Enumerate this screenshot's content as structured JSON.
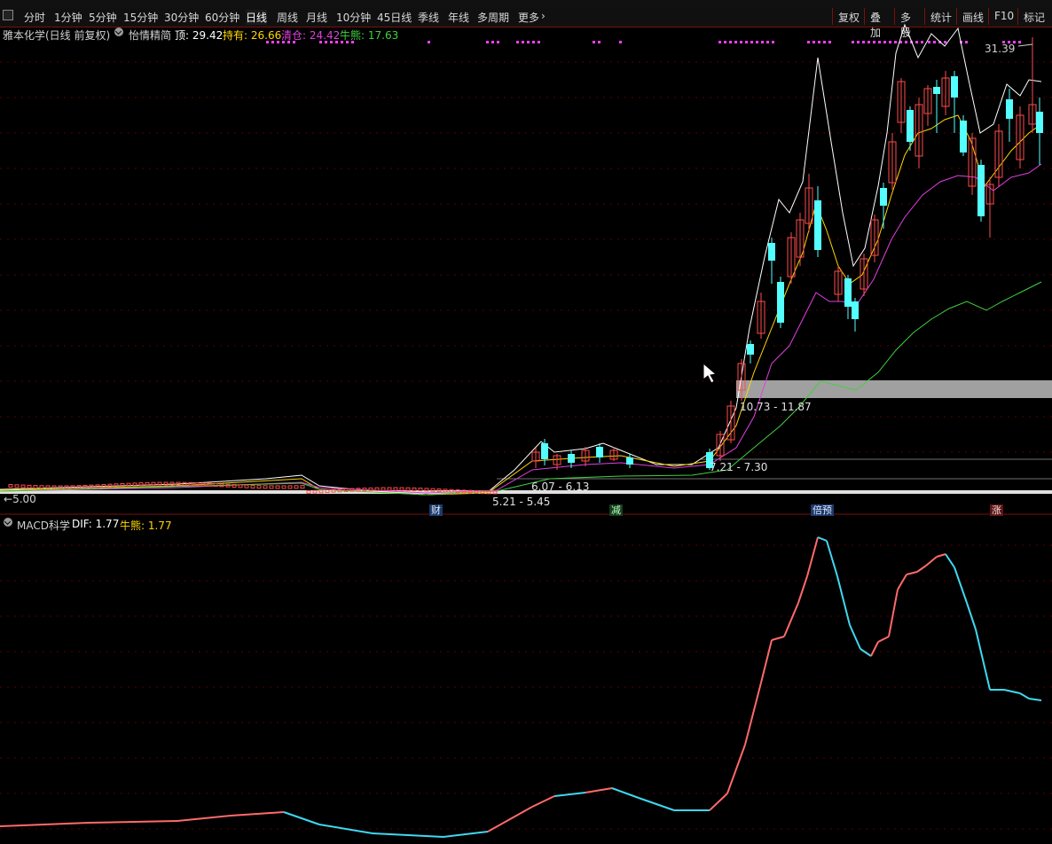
{
  "toolbar": {
    "periods": [
      "分时",
      "1分钟",
      "5分钟",
      "15分钟",
      "30分钟",
      "60分钟",
      "日线",
      "周线",
      "月线",
      "10分钟",
      "45日线",
      "季线",
      "年线",
      "多周期",
      "更多"
    ],
    "active_period": "日线",
    "right_buttons": [
      "复权",
      "叠加",
      "多股",
      "统计",
      "画线",
      "F10",
      "标记"
    ]
  },
  "main_info": {
    "title": "雅本化学(日线 前复权)",
    "indicator_name": "怡情精简",
    "top_label": "顶: 29.42",
    "hold_label": "持有: 26.66",
    "clear_label": "清仓: 24.42",
    "bear_label": "牛熊: 17.63"
  },
  "price_labels": {
    "high_marker": "31.39",
    "low_marker": "5.00",
    "zone_10": "10.73 - 11.87",
    "zone_7": "7.21 - 7.30",
    "zone_6": "6.07 - 6.13",
    "zone_5": "5.21 - 5.45"
  },
  "event_badges": [
    {
      "text": "财",
      "color": "#4a7cc8"
    },
    {
      "text": "减",
      "color": "#3da84a"
    },
    {
      "text": "倍预",
      "color": "#4a7cc8"
    },
    {
      "text": "涨",
      "color": "#c83a3a"
    }
  ],
  "macd_info": {
    "name": "MACD科学",
    "dif_label": "DIF: 1.77",
    "bear_label": "牛熊: 1.77"
  },
  "colors": {
    "up": "#ff4b4b",
    "down": "#54ffff",
    "white_line": "#ffffff",
    "yellow_line": "#ffd700",
    "magenta_line": "#e040e0",
    "green_line": "#40d040",
    "grid": "#5a0000",
    "macd_up": "#ff6a6a",
    "macd_down": "#40d8f0"
  }
}
